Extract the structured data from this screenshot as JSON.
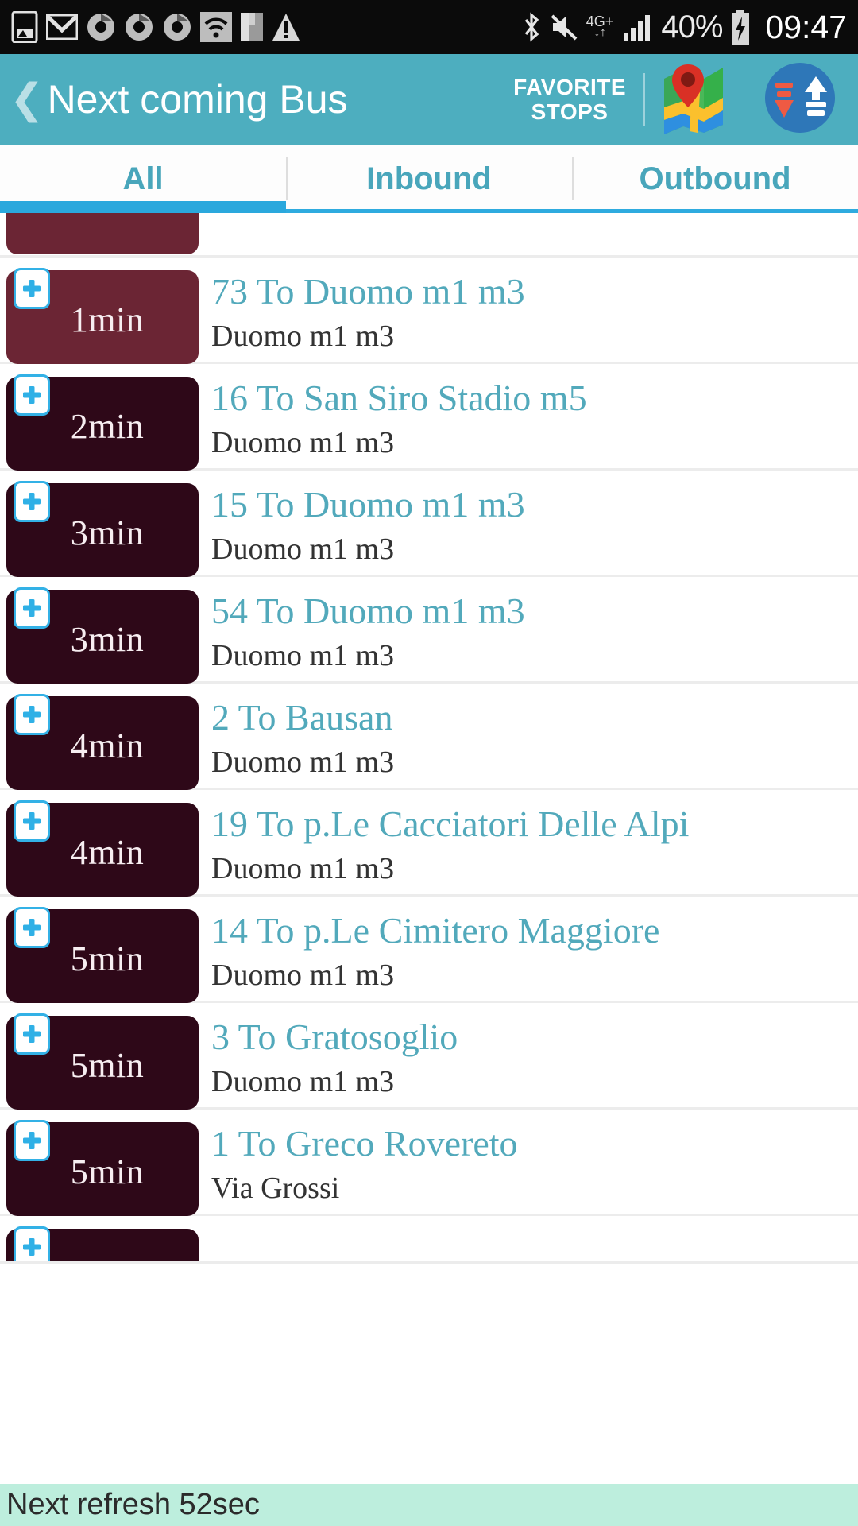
{
  "status_bar": {
    "left_icons": [
      "screenshot-icon",
      "gmail-icon",
      "chrome-icon",
      "chrome-icon",
      "chrome-icon",
      "wifi-icon",
      "app-icon",
      "warning-icon"
    ],
    "bluetooth_icon": "bluetooth-icon",
    "mute_icon": "mute-icon",
    "network_type": "4G+",
    "network_arrows": "↓↑",
    "signal_icon": "signal-bars-icon",
    "battery_percent": "40%",
    "battery_icon": "battery-charging-icon",
    "clock": "09:47"
  },
  "header": {
    "back_icon": "back-chevron-icon",
    "title": "Next coming Bus",
    "favorite_stops_line1": "FAVORITE",
    "favorite_stops_line2": "STOPS",
    "map_icon": "map-icon",
    "sort_icon": "sort-arrows-icon",
    "background_color": "#4daebf"
  },
  "tabs": [
    {
      "label": "All",
      "active": true
    },
    {
      "label": "Inbound",
      "active": false
    },
    {
      "label": "Outbound",
      "active": false
    }
  ],
  "list": {
    "partial_top_row": {
      "eta": "",
      "route": "",
      "stop": ""
    },
    "rows": [
      {
        "eta": "1min",
        "route": "73 To Duomo m1 m3",
        "stop": "Duomo m1 m3",
        "soon": true,
        "add_icon": "plus-icon"
      },
      {
        "eta": "2min",
        "route": "16 To San Siro Stadio m5",
        "stop": "Duomo m1 m3",
        "soon": false,
        "add_icon": "plus-icon"
      },
      {
        "eta": "3min",
        "route": "15 To Duomo m1 m3",
        "stop": "Duomo m1 m3",
        "soon": false,
        "add_icon": "plus-icon"
      },
      {
        "eta": "3min",
        "route": "54 To Duomo m1 m3",
        "stop": "Duomo m1 m3",
        "soon": false,
        "add_icon": "plus-icon"
      },
      {
        "eta": "4min",
        "route": "2 To Bausan",
        "stop": "Duomo m1 m3",
        "soon": false,
        "add_icon": "plus-icon"
      },
      {
        "eta": "4min",
        "route": "19 To p.Le Cacciatori Delle Alpi",
        "stop": "Duomo m1 m3",
        "soon": false,
        "add_icon": "plus-icon"
      },
      {
        "eta": "5min",
        "route": "14 To p.Le Cimitero Maggiore",
        "stop": "Duomo m1 m3",
        "soon": false,
        "add_icon": "plus-icon"
      },
      {
        "eta": "5min",
        "route": "3 To Gratosoglio",
        "stop": "Duomo m1 m3",
        "soon": false,
        "add_icon": "plus-icon"
      },
      {
        "eta": "5min",
        "route": "1 To Greco Rovereto",
        "stop": "Via Grossi",
        "soon": false,
        "add_icon": "plus-icon"
      }
    ],
    "colors": {
      "badge_soon": "#6b2534",
      "badge_default": "#2e0818",
      "route_title": "#52a9bb",
      "stop_text": "#333333",
      "divider": "#ececec"
    }
  },
  "footer": {
    "text": "Next refresh 52sec",
    "background_color": "#bdeedd"
  }
}
